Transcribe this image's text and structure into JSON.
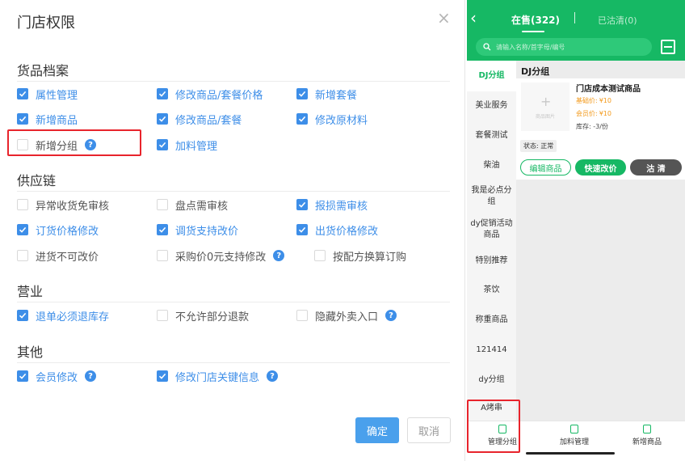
{
  "dialog": {
    "title": "门店权限",
    "close_glyph": "×",
    "sections": [
      {
        "title": "货品档案",
        "items": [
          {
            "label": "属性管理",
            "checked": true
          },
          {
            "label": "修改商品/套餐价格",
            "checked": true
          },
          {
            "label": "新增套餐",
            "checked": true
          },
          {
            "label": "新增商品",
            "checked": true
          },
          {
            "label": "修改商品/套餐",
            "checked": true
          },
          {
            "label": "修改原材料",
            "checked": true
          },
          {
            "label": "新增分组",
            "checked": false,
            "help": true
          },
          {
            "label": "加料管理",
            "checked": true
          }
        ]
      },
      {
        "title": "供应链",
        "items": [
          {
            "label": "异常收货免审核",
            "checked": false
          },
          {
            "label": "盘点需审核",
            "checked": false
          },
          {
            "label": "报损需审核",
            "checked": true
          },
          {
            "label": "订货价格修改",
            "checked": true
          },
          {
            "label": "调货支持改价",
            "checked": true
          },
          {
            "label": "出货价格修改",
            "checked": true
          },
          {
            "label": "进货不可改价",
            "checked": false
          },
          {
            "label": "采购价0元支持修改",
            "checked": false,
            "help": true
          },
          {
            "label": "按配方换算订购",
            "checked": false
          }
        ]
      },
      {
        "title": "营业",
        "items": [
          {
            "label": "退单必须退库存",
            "checked": true
          },
          {
            "label": "不允许部分退款",
            "checked": false
          },
          {
            "label": "隐藏外卖入口",
            "checked": false,
            "help": true
          }
        ]
      },
      {
        "title": "其他",
        "items": [
          {
            "label": "会员修改",
            "checked": true,
            "help": true
          },
          {
            "label": "修改门店关键信息",
            "checked": true,
            "help": true
          }
        ]
      }
    ],
    "help_glyph": "?",
    "confirm_label": "确定",
    "cancel_label": "取消"
  },
  "phone": {
    "tabs": {
      "active": "在售(322)",
      "inactive": "已沽清(0)"
    },
    "back_glyph": "‹",
    "search_placeholder": "请输入名称/首字母/编号",
    "categories": [
      "DJ分组",
      "美业服务",
      "套餐测试",
      "柴油",
      "我是必点分组",
      "dy促销活动商品",
      "特别推荐",
      "茶饮",
      "称重商品",
      "121414",
      "dy分组",
      "A烤串"
    ],
    "active_category": "DJ分组",
    "content_title": "DJ分组",
    "product": {
      "image_placeholder": "商品图片",
      "name": "门店成本测试商品",
      "base_price_label": "基础价:",
      "base_price": "¥10",
      "member_price_label": "会员价:",
      "member_price": "¥10",
      "stock": "库存: -3/份",
      "status": "状态: 正常",
      "edit_label": "编辑商品",
      "quick_price_label": "快速改价",
      "soldout_label": "沽 清"
    },
    "bottom_nav": [
      {
        "label": "管理分组"
      },
      {
        "label": "加料管理"
      },
      {
        "label": "新增商品"
      }
    ]
  },
  "colors": {
    "blue_accent": "#3d8ee8",
    "phone_green": "#16b864",
    "highlight_red": "#e8242c"
  }
}
